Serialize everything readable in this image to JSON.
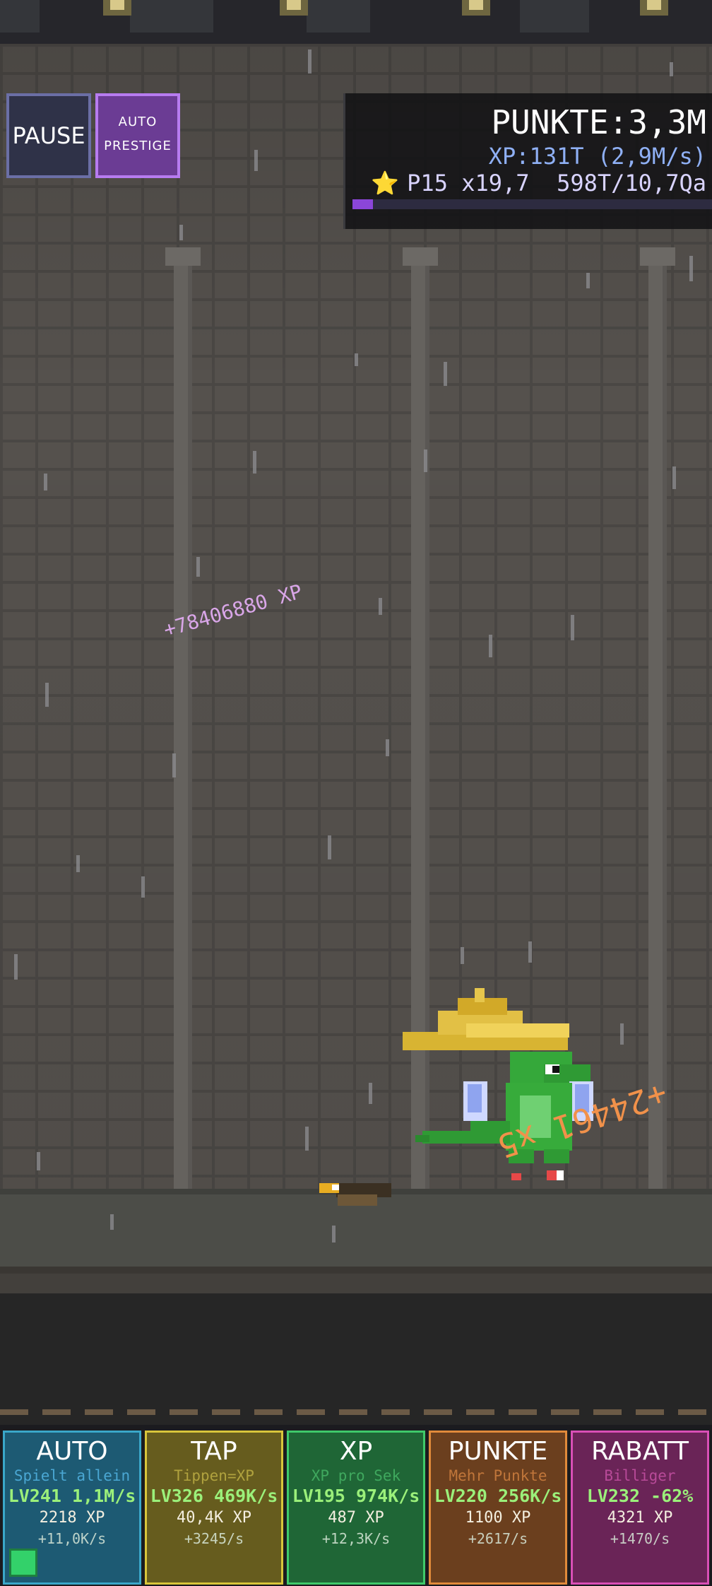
{
  "controls": {
    "pause_label": "PAUSE",
    "prestige_line1": "AUTO",
    "prestige_line2": "PRESTIGE"
  },
  "stats": {
    "score": "PUNKTE:3,3M",
    "xp": "XP:131T (2,9M/s)",
    "prestige_star": "⭐",
    "prestige": "P15 x19,7  598T/10,7Qa",
    "prestige_progress": 0.056
  },
  "floaters": {
    "xp_gain": "+78406880 XP",
    "points_gain": "+24461 x5"
  },
  "upgrades": [
    {
      "title": "AUTO",
      "desc": "Spielt allein",
      "level": "LV241 1,1M/s",
      "cost": "2218 XP",
      "rate": "+11,0K/s",
      "border": "#3aa7c9",
      "bg": "#1d5a73",
      "desc_color": "#4aa7d3"
    },
    {
      "title": "TAP",
      "desc": "Tippen=XP",
      "level": "LV326 469K/s",
      "cost": "40,4K XP",
      "rate": "+3245/s",
      "border": "#d8c53a",
      "bg": "#665c1e",
      "desc_color": "#b0a23e"
    },
    {
      "title": "XP",
      "desc": "XP pro Sek",
      "level": "LV195 974K/s",
      "cost": "487 XP",
      "rate": "+12,3K/s",
      "border": "#3fc96a",
      "bg": "#1f6636",
      "desc_color": "#3fa85e"
    },
    {
      "title": "PUNKTE",
      "desc": "Mehr Punkte",
      "level": "LV220 256K/s",
      "cost": "1100 XP",
      "rate": "+2617/s",
      "border": "#e08a3a",
      "bg": "#6b3f1e",
      "desc_color": "#c0763a"
    },
    {
      "title": "RABATT",
      "desc": "Billiger",
      "level": "LV232 -62%",
      "cost": "4321 XP",
      "rate": "+1470/s",
      "border": "#d94fb6",
      "bg": "#6a2457",
      "desc_color": "#b84a98"
    }
  ],
  "colors": {
    "accent": "#8b46d8",
    "level_text": "#9bf07a"
  }
}
